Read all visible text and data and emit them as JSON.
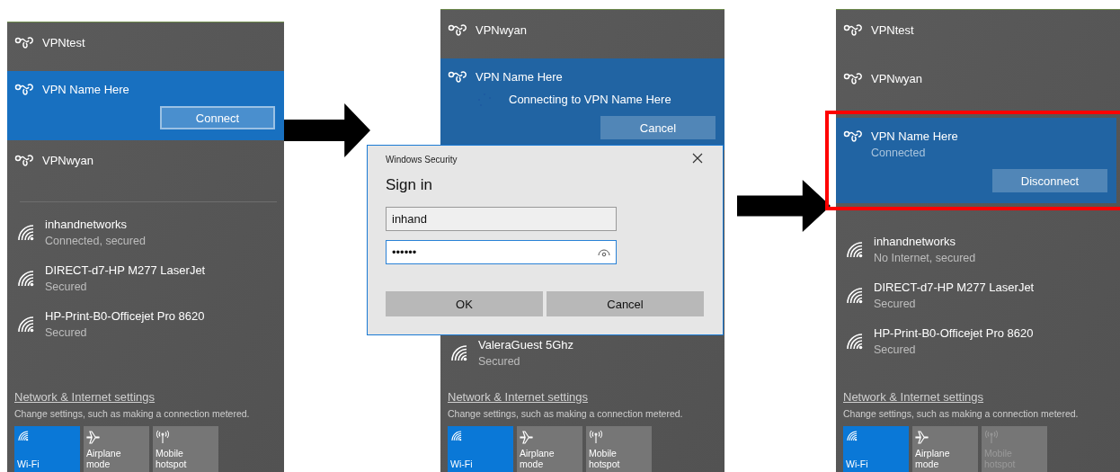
{
  "panels": [
    {
      "vpns": [
        {
          "name": "VPNtest",
          "selected": false
        },
        {
          "name": "VPN Name Here",
          "selected": true,
          "action": "Connect"
        },
        {
          "name": "VPNwyan",
          "selected": false
        }
      ],
      "networks": [
        {
          "name": "inhandnetworks",
          "status": "Connected, secured"
        },
        {
          "name": "DIRECT-d7-HP M277 LaserJet",
          "status": "Secured"
        },
        {
          "name": "HP-Print-B0-Officejet Pro 8620",
          "status": "Secured"
        }
      ],
      "settings_link": "Network & Internet settings",
      "settings_hint": "Change settings, such as making a connection metered.",
      "tiles": [
        {
          "kind": "wifi",
          "label": "Wi-Fi",
          "on": true,
          "disabled": false
        },
        {
          "kind": "airplane",
          "label": "Airplane mode",
          "on": false,
          "disabled": false
        },
        {
          "kind": "hotspot",
          "label": "Mobile hotspot",
          "on": false,
          "disabled": false
        }
      ]
    },
    {
      "vpns": [
        {
          "name": "VPNwyan",
          "selected": false
        },
        {
          "name": "VPN Name Here",
          "selected": true,
          "progress": "Connecting to VPN Name Here",
          "action": "Cancel"
        }
      ],
      "dialog": {
        "title": "Windows Security",
        "heading": "Sign in",
        "username": "inhand",
        "password": "••••••",
        "buttons": [
          "OK",
          "Cancel"
        ]
      },
      "networks": [
        {
          "name": "ValeraGuest 5Ghz",
          "status": "Secured"
        }
      ],
      "settings_link": "Network & Internet settings",
      "settings_hint": "Change settings, such as making a connection metered.",
      "tiles": [
        {
          "kind": "wifi",
          "label": "Wi-Fi",
          "on": true,
          "disabled": false
        },
        {
          "kind": "airplane",
          "label": "Airplane mode",
          "on": false,
          "disabled": false
        },
        {
          "kind": "hotspot",
          "label": "Mobile hotspot",
          "on": false,
          "disabled": false
        }
      ]
    },
    {
      "vpns": [
        {
          "name": "VPNtest",
          "selected": false
        },
        {
          "name": "VPNwyan",
          "selected": false
        },
        {
          "name": "VPN Name Here",
          "selected": true,
          "status": "Connected",
          "action": "Disconnect",
          "highlighted": true
        }
      ],
      "networks": [
        {
          "name": "inhandnetworks",
          "status": "No Internet, secured"
        },
        {
          "name": "DIRECT-d7-HP M277 LaserJet",
          "status": "Secured"
        },
        {
          "name": "HP-Print-B0-Officejet Pro 8620",
          "status": "Secured"
        }
      ],
      "settings_link": "Network & Internet settings",
      "settings_hint": "Change settings, such as making a connection metered.",
      "tiles": [
        {
          "kind": "wifi",
          "label": "Wi-Fi",
          "on": true,
          "disabled": false
        },
        {
          "kind": "airplane",
          "label": "Airplane mode",
          "on": false,
          "disabled": false
        },
        {
          "kind": "hotspot",
          "label": "Mobile hotspot",
          "on": false,
          "disabled": true
        }
      ]
    }
  ]
}
